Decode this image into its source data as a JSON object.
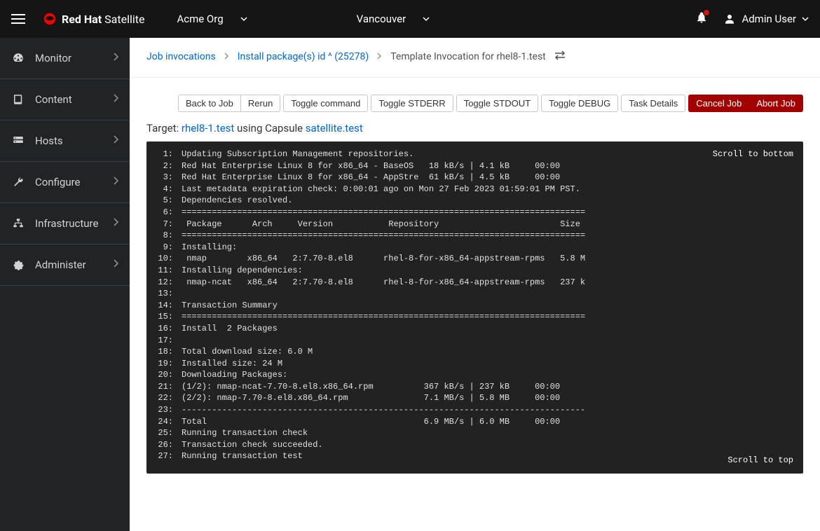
{
  "topbar": {
    "brand_prefix": "Red Hat",
    "brand_suffix": "Satellite",
    "org": "Acme Org",
    "location": "Vancouver",
    "user": "Admin User"
  },
  "sidebar": {
    "items": [
      {
        "label": "Monitor",
        "icon": "dashboard"
      },
      {
        "label": "Content",
        "icon": "book"
      },
      {
        "label": "Hosts",
        "icon": "server"
      },
      {
        "label": "Configure",
        "icon": "wrench"
      },
      {
        "label": "Infrastructure",
        "icon": "network"
      },
      {
        "label": "Administer",
        "icon": "gear"
      }
    ]
  },
  "breadcrumb": {
    "items": [
      {
        "label": "Job invocations",
        "link": true
      },
      {
        "label": "Install package(s) id ^ (25278)",
        "link": true
      },
      {
        "label": "Template Invocation for rhel8-1.test",
        "link": false
      }
    ]
  },
  "buttons": {
    "back": "Back to Job",
    "rerun": "Rerun",
    "toggle_command": "Toggle command",
    "toggle_stderr": "Toggle STDERR",
    "toggle_stdout": "Toggle STDOUT",
    "toggle_debug": "Toggle DEBUG",
    "task_details": "Task Details",
    "cancel": "Cancel Job",
    "abort": "Abort Job"
  },
  "target": {
    "prefix": "Target: ",
    "host": "rhel8-1.test",
    "middle": " using Capsule ",
    "capsule": "satellite.test"
  },
  "terminal": {
    "scroll_bottom": "Scroll to bottom",
    "scroll_top": "Scroll to top",
    "lines": [
      "Updating Subscription Management repositories.",
      "Red Hat Enterprise Linux 8 for x86_64 - BaseOS   18 kB/s | 4.1 kB     00:00",
      "Red Hat Enterprise Linux 8 for x86_64 - AppStre  61 kB/s | 4.5 kB     00:00",
      "Last metadata expiration check: 0:00:01 ago on Mon 27 Feb 2023 01:59:01 PM PST.",
      "Dependencies resolved.",
      "================================================================================",
      " Package      Arch     Version           Repository                        Size",
      "================================================================================",
      "Installing:",
      " nmap        x86_64   2:7.70-8.el8      rhel-8-for-x86_64-appstream-rpms   5.8 M",
      "Installing dependencies:",
      " nmap-ncat   x86_64   2:7.70-8.el8      rhel-8-for-x86_64-appstream-rpms   237 k",
      "",
      "Transaction Summary",
      "================================================================================",
      "Install  2 Packages",
      "",
      "Total download size: 6.0 M",
      "Installed size: 24 M",
      "Downloading Packages:",
      "(1/2): nmap-ncat-7.70-8.el8.x86_64.rpm          367 kB/s | 237 kB     00:00",
      "(2/2): nmap-7.70-8.el8.x86_64.rpm               7.1 MB/s | 5.8 MB     00:00",
      "--------------------------------------------------------------------------------",
      "Total                                           6.9 MB/s | 6.0 MB     00:00",
      "Running transaction check",
      "Transaction check succeeded.",
      "Running transaction test"
    ]
  }
}
